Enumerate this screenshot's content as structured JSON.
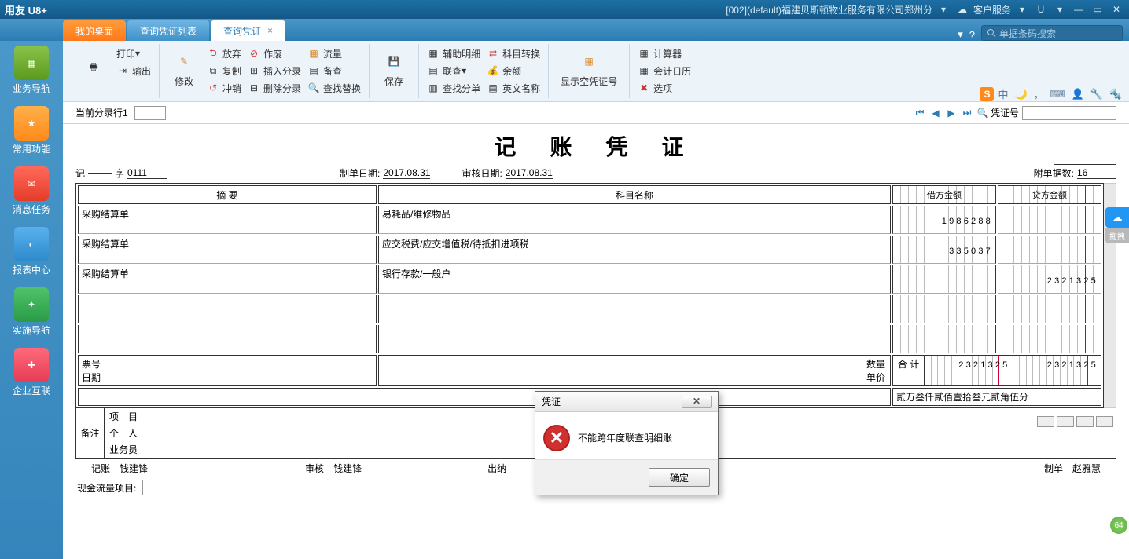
{
  "titlebar": {
    "brand": "用友 U8+",
    "corp": "[002](default)福建贝斯顿物业服务有限公司郑州分",
    "cust_service": "客户服务",
    "drop": "▾",
    "u": "U"
  },
  "tabs": {
    "desktop": "我的桌面",
    "list": "查询凭证列表",
    "query": "查询凭证"
  },
  "search": {
    "placeholder": "单据条码搜索"
  },
  "sidebar": {
    "items": [
      {
        "label": "业务导航"
      },
      {
        "label": "常用功能"
      },
      {
        "label": "消息任务"
      },
      {
        "label": "报表中心"
      },
      {
        "label": "实施导航"
      },
      {
        "label": "企业互联"
      }
    ]
  },
  "ribbon": {
    "print": "打印",
    "export": "输出",
    "modify": "修改",
    "abandon": "放弃",
    "copy": "复制",
    "reverse": "冲销",
    "void": "作废",
    "insert": "插入分录",
    "delete": "删除分录",
    "flow": "流量",
    "backup": "备查",
    "findreplace": "查找替换",
    "save": "保存",
    "assist": "辅助明细",
    "lookup": "联查",
    "findentry": "查找分单",
    "subjswitch": "科目转换",
    "balance": "余额",
    "enname": "英文名称",
    "showempty": "显示空凭证号",
    "calc": "计算器",
    "cal": "会计日历",
    "options": "选项"
  },
  "nav": {
    "current_row_label": "当前分录行1",
    "voucher_no_label": "凭证号"
  },
  "voucher": {
    "title": "记 账 凭 证",
    "word_prefix": "记",
    "word_suffix": "字",
    "number": "0111",
    "make_date_label": "制单日期:",
    "make_date": "2017.08.31",
    "audit_date_label": "审核日期:",
    "audit_date": "2017.08.31",
    "attach_label": "附单据数:",
    "attach_count": "16",
    "headers": {
      "summary": "摘 要",
      "subject": "科目名称",
      "debit": "借方金额",
      "credit": "贷方金额"
    },
    "rows": [
      {
        "summary": "采购结算单",
        "subject": "易耗品/维修物品",
        "debit": "1986288",
        "credit": ""
      },
      {
        "summary": "采购结算单",
        "subject": "应交税费/应交增值税/待抵扣进项税",
        "debit": "335037",
        "credit": ""
      },
      {
        "summary": "采购结算单",
        "subject": "银行存款/一般户",
        "debit": "",
        "credit": "2321325"
      }
    ],
    "bill_no": "票号",
    "bill_date": "日期",
    "qty": "数量",
    "price": "单价",
    "total_label": "合 计",
    "total_debit": "2321325",
    "total_credit": "2321325",
    "amount_words": "贰万叁仟贰佰壹拾叁元贰角伍分",
    "remark": "备注",
    "project": "项　目",
    "person": "个　人",
    "salesman": "业务员",
    "sign": {
      "book": "记账",
      "book_name": "钱建锋",
      "audit": "审核",
      "audit_name": "钱建锋",
      "cashier": "出纳",
      "make": "制单",
      "make_name": "赵雅慧"
    },
    "cash_flow_label": "现金流量项目:"
  },
  "dialog": {
    "title": "凭证",
    "message": "不能跨年度联查明细账",
    "ok": "确定"
  }
}
